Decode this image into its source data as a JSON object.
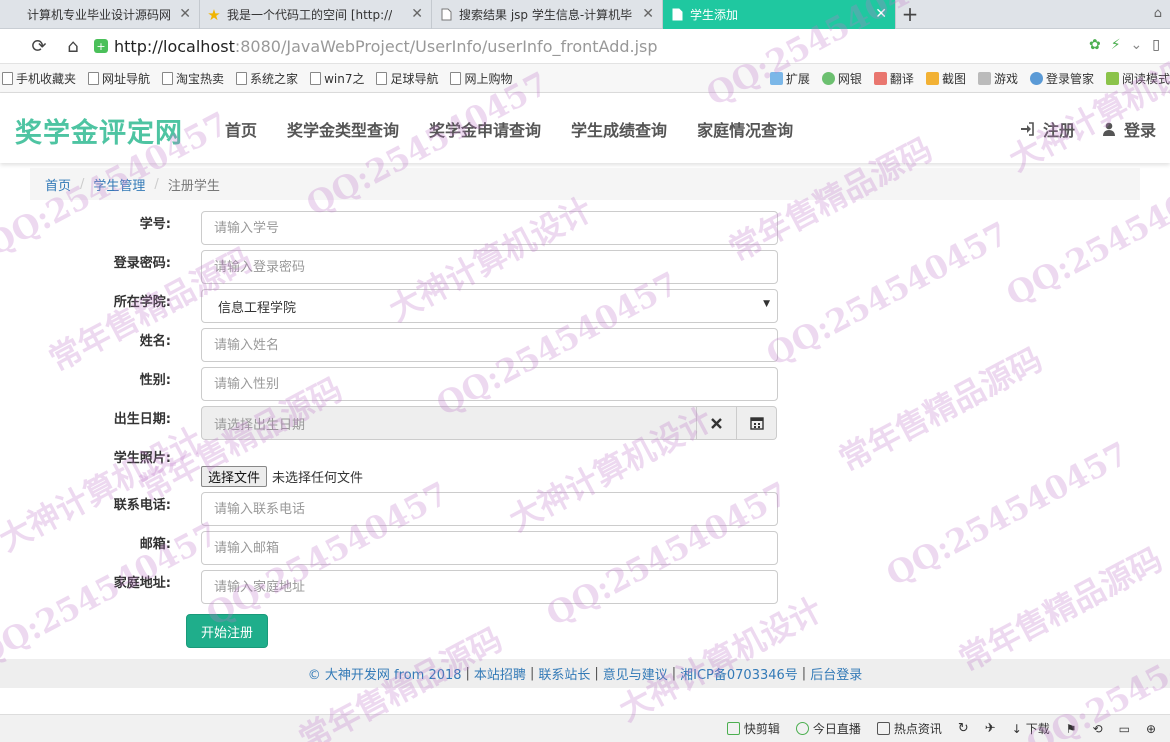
{
  "browser": {
    "tabs": [
      {
        "title": "计算机专业毕业设计源码网",
        "icon": "page-icon"
      },
      {
        "title": "我是一个代码工的空间 [http://",
        "icon": "star-icon"
      },
      {
        "title": "搜索结果 jsp 学生信息-计算机毕",
        "icon": "page-icon"
      },
      {
        "title": "学生添加",
        "icon": "page-icon",
        "active": true
      }
    ],
    "new_tab": "+",
    "url_host": "http://localhost",
    "url_path": ":8080/JavaWebProject/UserInfo/userInfo_frontAdd.jsp",
    "bookmarks": [
      "手机收藏夹",
      "网址导航",
      "淘宝热卖",
      "系统之家",
      "win7之",
      "足球导航",
      "网上购物"
    ],
    "tools": [
      "扩展",
      "网银",
      "翻译",
      "截图",
      "游戏",
      "登录管家",
      "阅读模式"
    ]
  },
  "site": {
    "brand": "奖学金评定网",
    "menu": [
      "首页",
      "奖学金类型查询",
      "奖学金申请查询",
      "学生成绩查询",
      "家庭情况查询"
    ],
    "register": "注册",
    "login": "登录"
  },
  "breadcrumb": {
    "home": "首页",
    "section": "学生管理",
    "current": "注册学生",
    "separator": "/"
  },
  "form": {
    "student_no": {
      "label": "学号:",
      "placeholder": "请输入学号"
    },
    "password": {
      "label": "登录密码:",
      "placeholder": "请输入登录密码"
    },
    "college": {
      "label": "所在学院:",
      "value": "信息工程学院"
    },
    "name": {
      "label": "姓名:",
      "placeholder": "请输入姓名"
    },
    "gender": {
      "label": "性别:",
      "placeholder": "请输入性别"
    },
    "birthday": {
      "label": "出生日期:",
      "placeholder": "请选择出生日期"
    },
    "photo": {
      "label": "学生照片:",
      "button": "选择文件",
      "status": "未选择任何文件"
    },
    "phone": {
      "label": "联系电话:",
      "placeholder": "请输入联系电话"
    },
    "email": {
      "label": "邮箱:",
      "placeholder": "请输入邮箱"
    },
    "address": {
      "label": "家庭地址:",
      "placeholder": "请输入家庭地址"
    },
    "submit": "开始注册"
  },
  "footer": {
    "copyright": "© 大神开发网 from 2018",
    "links": [
      "本站招聘",
      "联系站长",
      "意见与建议",
      "湘ICP备0703346号",
      "后台登录"
    ]
  },
  "statusbar": [
    "快剪辑",
    "今日直播",
    "热点资讯",
    "下载"
  ],
  "watermark": [
    "QQ:254540457",
    "常年售精品源码",
    "大神计算机设计"
  ],
  "colors": {
    "accent": "#1fae8b",
    "brand": "#4ec4a2",
    "active_tab": "#1fc8a0",
    "link": "#337ab7"
  }
}
